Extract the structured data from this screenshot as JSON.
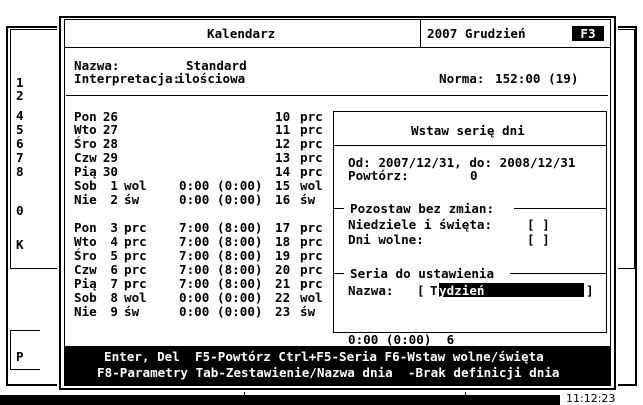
{
  "title": "Kalendarz",
  "period": "2007 Grudzień",
  "f_key": "F3",
  "header": {
    "name_label": "Nazwa:",
    "name_value": "Standard",
    "interp_label": "Interpretacja:",
    "interp_value": "ilościowa",
    "norma_label": "Norma:",
    "norma_value": "152:00 (19)"
  },
  "bg_row_numbers": [
    "1",
    "2",
    "4",
    "5",
    "6",
    "7",
    "8",
    "0",
    "K",
    "P"
  ],
  "calendar_rows": [
    {
      "day": "Pon",
      "num": "26",
      "type": "",
      "hours": "",
      "norm": "",
      "week": "10",
      "wtype": "prc"
    },
    {
      "day": "Wto",
      "num": "27",
      "type": "",
      "hours": "",
      "norm": "",
      "week": "11",
      "wtype": "prc"
    },
    {
      "day": "Śro",
      "num": "28",
      "type": "",
      "hours": "",
      "norm": "",
      "week": "12",
      "wtype": "prc"
    },
    {
      "day": "Czw",
      "num": "29",
      "type": "",
      "hours": "",
      "norm": "",
      "week": "13",
      "wtype": "prc"
    },
    {
      "day": "Pią",
      "num": "30",
      "type": "",
      "hours": "",
      "norm": "",
      "week": "14",
      "wtype": "prc"
    },
    {
      "day": "Sob",
      "num": "1",
      "type": "wol",
      "hours": "0:00",
      "norm": "(0:00)",
      "week": "15",
      "wtype": "wol"
    },
    {
      "day": "Nie",
      "num": "2",
      "type": "św",
      "hours": "0:00",
      "norm": "(0:00)",
      "week": "16",
      "wtype": "św"
    },
    {
      "day": "Pon",
      "num": "3",
      "type": "prc",
      "hours": "7:00",
      "norm": "(8:00)",
      "week": "17",
      "wtype": "prc"
    },
    {
      "day": "Wto",
      "num": "4",
      "type": "prc",
      "hours": "7:00",
      "norm": "(8:00)",
      "week": "18",
      "wtype": "prc"
    },
    {
      "day": "Śro",
      "num": "5",
      "type": "prc",
      "hours": "7:00",
      "norm": "(8:00)",
      "week": "19",
      "wtype": "prc"
    },
    {
      "day": "Czw",
      "num": "6",
      "type": "prc",
      "hours": "7:00",
      "norm": "(8:00)",
      "week": "20",
      "wtype": "prc"
    },
    {
      "day": "Pią",
      "num": "7",
      "type": "prc",
      "hours": "7:00",
      "norm": "(8:00)",
      "week": "21",
      "wtype": "prc"
    },
    {
      "day": "Sob",
      "num": "8",
      "type": "wol",
      "hours": "0:00",
      "norm": "(0:00)",
      "week": "22",
      "wtype": "wol"
    },
    {
      "day": "Nie",
      "num": "9",
      "type": "św",
      "hours": "0:00",
      "norm": "(0:00)",
      "week": "23",
      "wtype": "św"
    }
  ],
  "last_row_extra": "0:00 (0:00)  6",
  "subdialog": {
    "title": "Wstaw serię dni",
    "from_to": "Od: 2007/12/31, do: 2008/12/31",
    "repeat_label": "Powtórz:",
    "repeat_value": "0",
    "group1_title": "Pozostaw bez zmian:",
    "sundays_label": "Niedziele i święta:",
    "sundays_value": "[ ]",
    "free_days_label": "Dni wolne:",
    "free_days_value": "[ ]",
    "group2_title": "Seria do ustawienia",
    "series_label": "Nazwa:",
    "series_open": "[",
    "series_cursor_char": "T",
    "series_value": "ydzień",
    "series_close": "]"
  },
  "footer": {
    "line1": "Enter, Del  F5-Powtórz Ctrl+F5-Seria F6-Wstaw wolne/święta",
    "line2": "F8-Parametry Tab-Zestawienie/Nazwa dnia  -Brak definicji dnia"
  },
  "clock": "11:12:23",
  "colors": {
    "background": "#000000",
    "window": "#ffffff",
    "highlight": "#000000"
  }
}
